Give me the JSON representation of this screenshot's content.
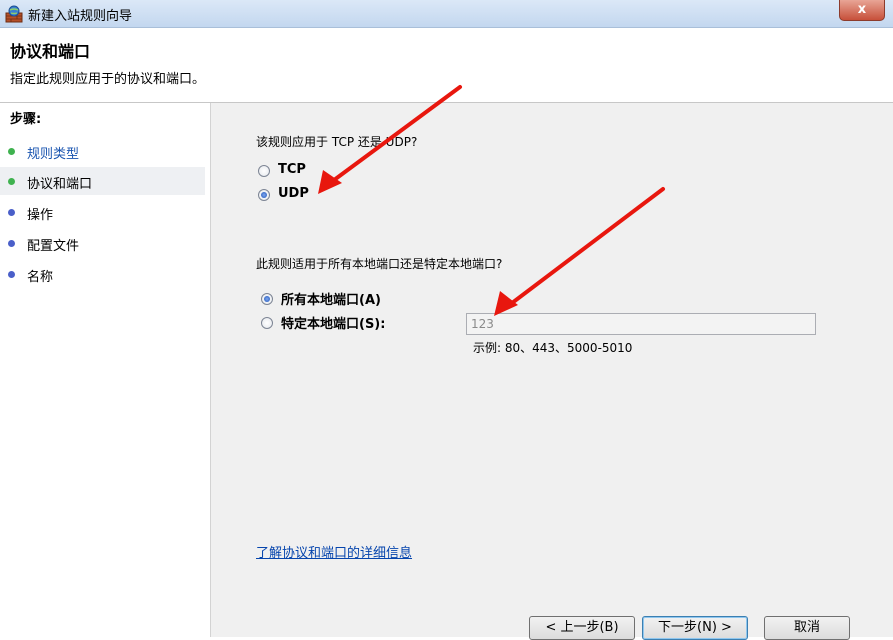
{
  "window": {
    "title": "新建入站规则向导",
    "close_label": "x"
  },
  "header": {
    "title": "协议和端口",
    "subtitle": "指定此规则应用于的协议和端口。"
  },
  "sidebar": {
    "steps_label": "步骤:",
    "items": [
      {
        "label": "规则类型",
        "color": "#3fb24f"
      },
      {
        "label": "协议和端口",
        "color": "#3fb24f"
      },
      {
        "label": "操作",
        "color": "#4a5fc9"
      },
      {
        "label": "配置文件",
        "color": "#4a5fc9"
      },
      {
        "label": "名称",
        "color": "#4a5fc9"
      }
    ]
  },
  "main": {
    "protocol_question": "该规则应用于 TCP 还是 UDP?",
    "protocol_options": [
      "TCP",
      "UDP"
    ],
    "protocol_selected": "UDP",
    "port_question": "此规则适用于所有本地端口还是特定本地端口?",
    "port_option_all": "所有本地端口(A)",
    "port_option_specific": "特定本地端口(S):",
    "port_selected": "所有本地端口(A)",
    "port_value": "123",
    "port_example": "示例: 80、443、5000-5010",
    "help_link": "了解协议和端口的详细信息"
  },
  "buttons": {
    "back": "< 上一步(B)",
    "next": "下一步(N) >",
    "cancel": "取消"
  },
  "colors": {
    "annotation_arrow": "#e8170e",
    "link": "#0645ad"
  }
}
